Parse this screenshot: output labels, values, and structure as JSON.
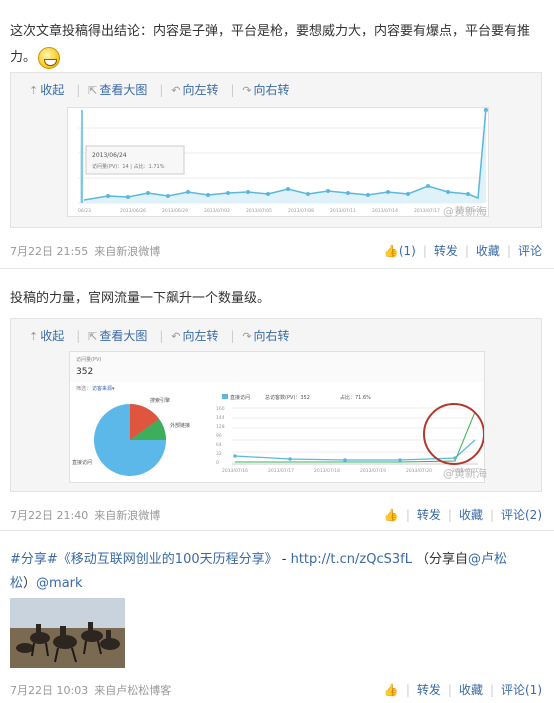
{
  "posts": [
    {
      "text_line1": "这次文章投稿得出结论：内容是子弹，平台是枪，要想威力大，内容要有爆点，平台要有推",
      "text_line2": "力。",
      "toolbar": {
        "collapse": "收起",
        "view_large": "查看大图",
        "rotate_left": "向左转",
        "rotate_right": "向右转"
      },
      "chart": {
        "tooltip_date": "2013/06/24",
        "tooltip_text": "访问量(PV)：14  |  占比：1.71%",
        "x_ticks": [
          "06/23",
          "2013/06/26",
          "2013/06/29",
          "2013/07/02",
          "2013/07/05",
          "2013/07/08",
          "2013/07/11",
          "2013/07/14",
          "2013/07/17",
          "2013/07/20"
        ]
      },
      "watermark": "@黄新海",
      "time": "7月22日 21:55",
      "source": "来自新浪微博",
      "like_count": "(1)",
      "forward": "转发",
      "favorite": "收藏",
      "comment": "评论"
    },
    {
      "text": "投稿的力量，官网流量一下飙升一个数量级。",
      "toolbar": {
        "collapse": "收起",
        "view_large": "查看大图",
        "rotate_left": "向左转",
        "rotate_right": "向右转"
      },
      "chart": {
        "stat_label": "访问量(PV)",
        "stat_value": "352",
        "filter_label": "筛选：",
        "filter_value": "访客来源▾",
        "pie_labels": [
          "搜索引擎",
          "外部链接",
          "直接访问"
        ],
        "legend_items": [
          "直接访问",
          "总访客数(PV)：352",
          "占比：71.6%"
        ],
        "y_ticks": [
          "160",
          "144",
          "128",
          "96",
          "64",
          "32",
          "0"
        ],
        "x_ticks": [
          "2013/07/16",
          "2013/07/17",
          "2013/07/18",
          "2013/07/19",
          "2013/07/20",
          "2013/07/21"
        ]
      },
      "watermark": "@黄新海",
      "time": "7月22日 21:40",
      "source": "来自新浪微博",
      "forward": "转发",
      "favorite": "收藏",
      "comment": "评论(2)"
    },
    {
      "hashtag": "#分享#",
      "title": "《移动互联网创业的100天历程分享》",
      "dash": " - ",
      "link": "http://t.cn/zQcS3fL",
      "share_from": "（分享自",
      "mention": "@卢松",
      "line2_pre": "松",
      "line2_close": "）",
      "mention2": "@mark",
      "time": "7月22日 10:03",
      "source": "来自卢松松博客",
      "forward": "转发",
      "favorite": "收藏",
      "comment": "评论(1)"
    }
  ],
  "colors": {
    "link": "#3a6aa8",
    "meta": "#999999",
    "chart_line": "#5bb8dc",
    "pie_blue": "#5bb8e8",
    "pie_red": "#e0553e",
    "pie_green": "#3fae5a",
    "circle": "#b5372c"
  }
}
